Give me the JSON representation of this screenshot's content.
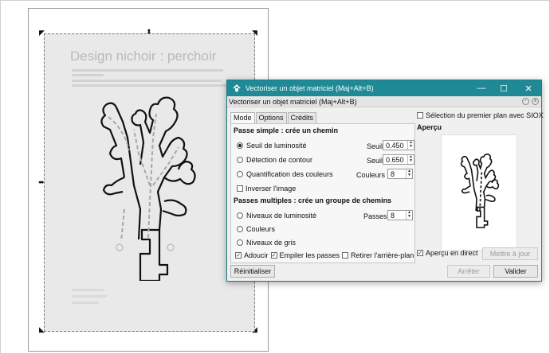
{
  "image": {
    "title": "Design nichoir : perchoir"
  },
  "dialog": {
    "title": "Vectoriser un objet matriciel (Maj+Alt+B)",
    "subtitle": "Vectoriser un objet matriciel (Maj+Alt+B)",
    "tabs": [
      "Mode",
      "Options",
      "Crédits"
    ],
    "single_pass_title": "Passe simple : crée un chemin",
    "single_options": [
      {
        "label": "Seuil de luminosité",
        "param": "Seuil :",
        "value": "0.450",
        "selected": true
      },
      {
        "label": "Détection de contour",
        "param": "Seuil :",
        "value": "0.650",
        "selected": false
      },
      {
        "label": "Quantification des couleurs",
        "param": "Couleurs :",
        "value": "8",
        "selected": false
      }
    ],
    "invert_label": "Inverser l'image",
    "multi_pass_title": "Passes multiples : crée un groupe de chemins",
    "multi_options": [
      {
        "label": "Niveaux de luminosité",
        "param": "Passes :",
        "value": "8",
        "selected": false
      },
      {
        "label": "Couleurs",
        "selected": false
      },
      {
        "label": "Niveaux de gris",
        "selected": false
      }
    ],
    "smooth_label": "Adoucir",
    "stack_label": "Empiler les passes",
    "remove_bg_label": "Retirer l'arrière-plan",
    "siox_label": "Sélection du premier plan avec SIOX",
    "preview_title": "Aperçu",
    "live_preview_label": "Aperçu en direct",
    "update_button": "Mettre à jour",
    "reset_button": "Réinitialiser",
    "stop_button": "Arrêter",
    "ok_button": "Valider"
  },
  "colors": {
    "titlebar": "#1f8a95",
    "drawing": "#111111",
    "dashes": "#a8a8a8"
  },
  "icons": [
    "inkscape-icon",
    "minimize-icon",
    "maximize-icon",
    "close-icon",
    "transform-handle-icon"
  ]
}
